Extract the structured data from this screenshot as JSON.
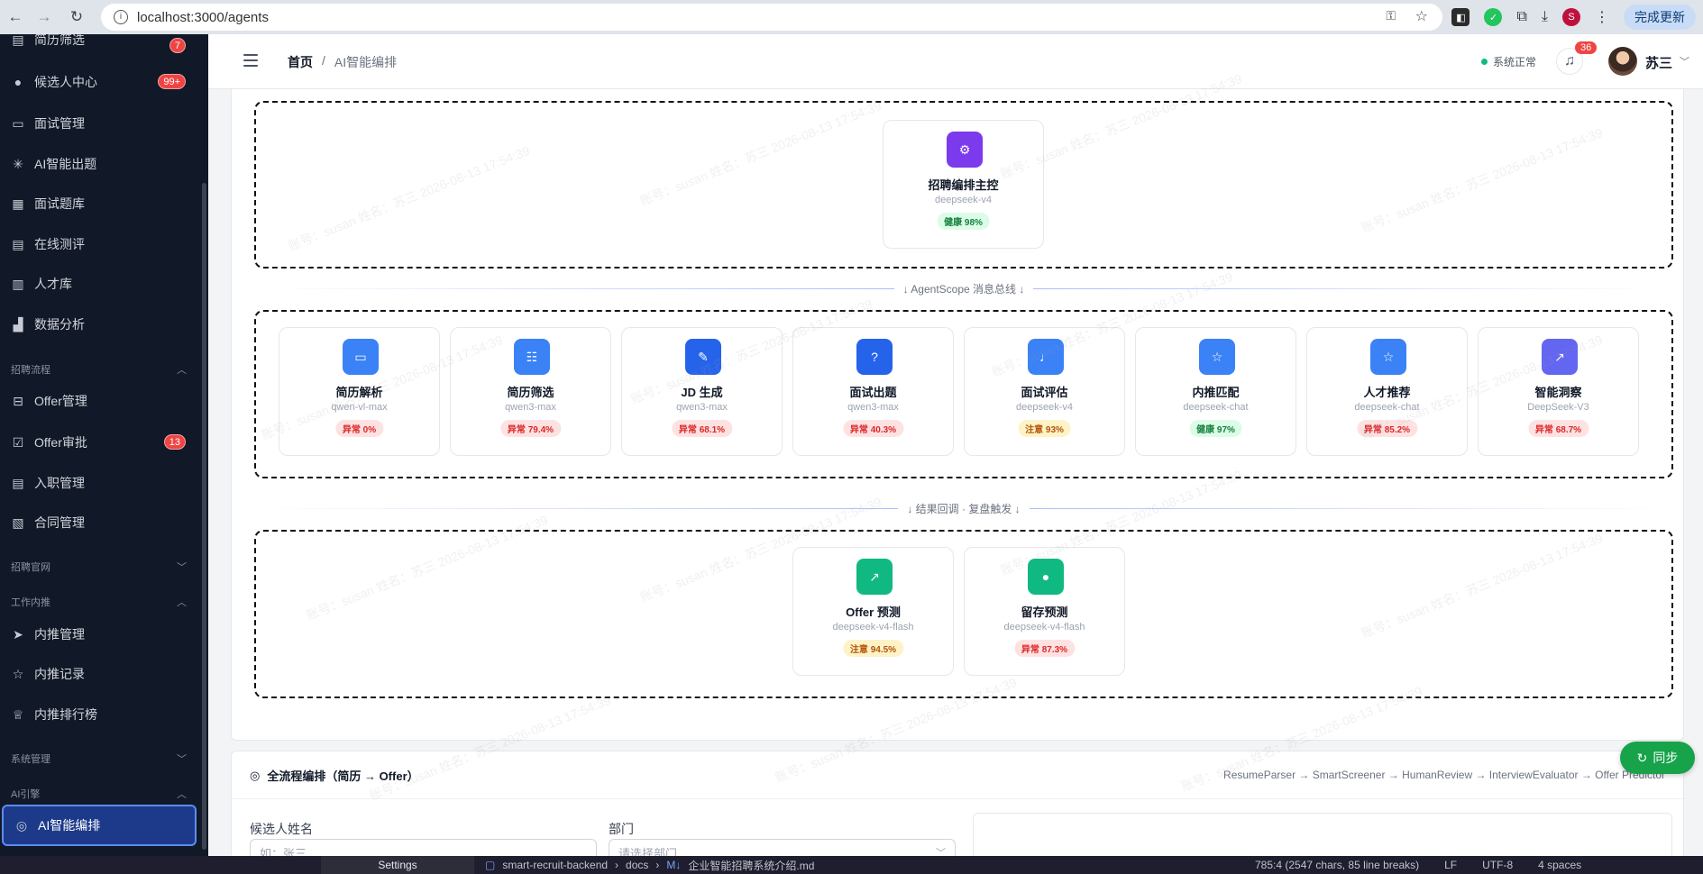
{
  "browser": {
    "url": "localhost:3000/agents",
    "update_label": "完成更新",
    "profile_initial": "S"
  },
  "sidebar": {
    "items": [
      {
        "label": "简历筛选",
        "badge": "7"
      },
      {
        "label": "候选人中心",
        "badge": "99+"
      },
      {
        "label": "面试管理"
      },
      {
        "label": "AI智能出题"
      },
      {
        "label": "面试题库"
      },
      {
        "label": "在线测评"
      },
      {
        "label": "人才库"
      },
      {
        "label": "数据分析"
      },
      {
        "label": "Offer管理"
      },
      {
        "label": "Offer审批",
        "badge": "13"
      },
      {
        "label": "入职管理"
      },
      {
        "label": "合同管理"
      },
      {
        "label": "内推管理"
      },
      {
        "label": "内推记录"
      },
      {
        "label": "内推排行榜"
      },
      {
        "label": "AI智能编排"
      }
    ],
    "groups": [
      "招聘流程",
      "招聘官网",
      "工作内推",
      "系统管理",
      "AI引擎"
    ]
  },
  "topbar": {
    "breadcrumb_home": "首页",
    "breadcrumb_sep": "/",
    "breadcrumb_current": "AI智能编排",
    "status": "系统正常",
    "notifications": "36",
    "user_name": "苏三"
  },
  "orchestration": {
    "master": {
      "title": "招聘编排主控",
      "model": "deepseek-v4",
      "status": "健康 98%",
      "level": "green"
    },
    "bus_label": "↓ AgentScope 消息总线 ↓",
    "agents": [
      {
        "title": "简历解析",
        "model": "qwen-vl-max",
        "status": "异常 0%",
        "level": "red",
        "color": "#3b82f6",
        "icon": "folder-icon"
      },
      {
        "title": "简历筛选",
        "model": "qwen3-max",
        "status": "异常 79.4%",
        "level": "red",
        "color": "#3b82f6",
        "icon": "filter-icon"
      },
      {
        "title": "JD 生成",
        "model": "qwen3-max",
        "status": "异常 68.1%",
        "level": "red",
        "color": "#2563eb",
        "icon": "pen-icon"
      },
      {
        "title": "面试出题",
        "model": "qwen3-max",
        "status": "异常 40.3%",
        "level": "red",
        "color": "#2563eb",
        "icon": "question-icon"
      },
      {
        "title": "面试评估",
        "model": "deepseek-v4",
        "status": "注意 93%",
        "level": "amber",
        "color": "#3b82f6",
        "icon": "mic-icon"
      },
      {
        "title": "内推匹配",
        "model": "deepseek-chat",
        "status": "健康 97%",
        "level": "green",
        "color": "#3b82f6",
        "icon": "star-icon"
      },
      {
        "title": "人才推荐",
        "model": "deepseek-chat",
        "status": "异常 85.2%",
        "level": "red",
        "color": "#3b82f6",
        "icon": "star-icon"
      },
      {
        "title": "智能洞察",
        "model": "DeepSeek-V3",
        "status": "异常 68.7%",
        "level": "red",
        "color": "#6366f1",
        "icon": "chart-icon"
      }
    ],
    "feedback_label": "↓ 结果回调 · 复盘触发 ↓",
    "predictors": [
      {
        "title": "Offer 预测",
        "model": "deepseek-v4-flash",
        "status": "注意 94.5%",
        "level": "amber",
        "color": "#10b981",
        "icon": "trend-icon"
      },
      {
        "title": "留存预测",
        "model": "deepseek-v4-flash",
        "status": "异常 87.3%",
        "level": "red",
        "color": "#10b981",
        "icon": "user-icon"
      }
    ]
  },
  "pipeline": {
    "title": "全流程编排（简历 → Offer）",
    "flow": "ResumeParser → SmartScreener → HumanReview → InterviewEvaluator → Offer Predictor",
    "candidate_label": "候选人姓名",
    "candidate_placeholder": "如：张三",
    "dept_label": "部门",
    "dept_placeholder": "请选择部门"
  },
  "sync_label": "同步",
  "watermark": "账号：susan 姓名：苏三 2026-08-13 17:54:39",
  "bottombar": {
    "settings": "Settings",
    "project": "smart-recruit-backend",
    "path1": "docs",
    "file": "企业智能招聘系统介绍.md",
    "stats": "785:4 (2547 chars, 85 line breaks)",
    "eol": "LF",
    "encoding": "UTF-8",
    "indent": "4 spaces"
  }
}
